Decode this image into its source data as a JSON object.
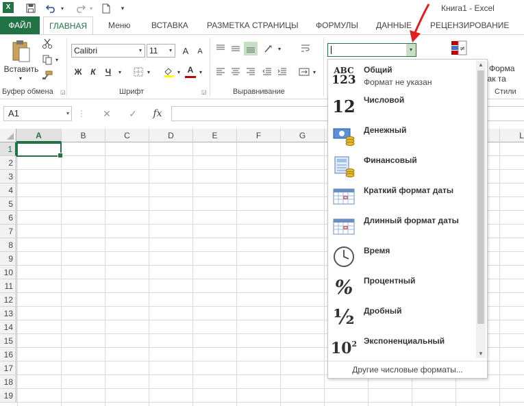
{
  "window": {
    "title": "Книга1 - Excel"
  },
  "quick_access": {
    "logo": "X",
    "save_icon": "save-icon",
    "undo_icon": "undo-icon",
    "redo_icon": "redo-icon",
    "new_icon": "new-file-icon"
  },
  "tabs": [
    {
      "label": "ФАЙЛ"
    },
    {
      "label": "ГЛАВНАЯ"
    },
    {
      "label": "Меню"
    },
    {
      "label": "ВСТАВКА"
    },
    {
      "label": "РАЗМЕТКА СТРАНИЦЫ"
    },
    {
      "label": "ФОРМУЛЫ"
    },
    {
      "label": "ДАННЫЕ"
    },
    {
      "label": "РЕЦЕНЗИРОВАНИЕ"
    }
  ],
  "ribbon": {
    "clipboard": {
      "label": "Буфер обмена",
      "paste_label": "Вставить"
    },
    "font": {
      "label": "Шрифт",
      "font_name": "Calibri",
      "font_size": "11",
      "bold": "Ж",
      "italic": "К",
      "underline": "Ч",
      "grow": "A",
      "shrink": "A",
      "font_color_letter": "A"
    },
    "alignment": {
      "label": "Выравнивание"
    },
    "number": {
      "format_value": ""
    },
    "styles": {
      "label": "Стили",
      "format_table_line1": "Форма",
      "format_table_line2": "как та"
    }
  },
  "formula_bar": {
    "name_box": "A1",
    "cancel": "✕",
    "enter": "✓",
    "fx": "fx",
    "value": ""
  },
  "grid": {
    "columns": [
      "A",
      "B",
      "C",
      "D",
      "E",
      "F",
      "G",
      "L"
    ],
    "rows": [
      "1",
      "2",
      "3",
      "4",
      "5",
      "6",
      "7",
      "8",
      "9",
      "10",
      "11",
      "12",
      "13",
      "14",
      "15",
      "16",
      "17",
      "18",
      "19"
    ],
    "active_cell": "A1"
  },
  "number_format_menu": {
    "items": [
      {
        "label": "Общий",
        "sub": "Формат не указан",
        "icon": "abc-123-icon",
        "icon_text_top": "ABC",
        "icon_text_bottom": "123"
      },
      {
        "label": "Числовой",
        "icon": "number-12-icon",
        "icon_text_top": "12"
      },
      {
        "label": "Денежный",
        "icon": "currency-icon"
      },
      {
        "label": "Финансовый",
        "icon": "accounting-icon"
      },
      {
        "label": "Краткий формат даты",
        "icon": "short-date-calendar-icon"
      },
      {
        "label": "Длинный формат даты",
        "icon": "long-date-calendar-icon"
      },
      {
        "label": "Время",
        "icon": "clock-icon"
      },
      {
        "label": "Процентный",
        "icon": "percent-icon",
        "icon_text_top": "%"
      },
      {
        "label": "Дробный",
        "icon": "fraction-icon",
        "icon_text_top": "½"
      },
      {
        "label": "Экспоненциальный",
        "icon": "scientific-icon",
        "icon_text_top": "10",
        "icon_text_sup": "2"
      }
    ],
    "more_label": "Другие числовые форматы..."
  },
  "colors": {
    "accent": "#217346",
    "arrow": "#e02020"
  }
}
